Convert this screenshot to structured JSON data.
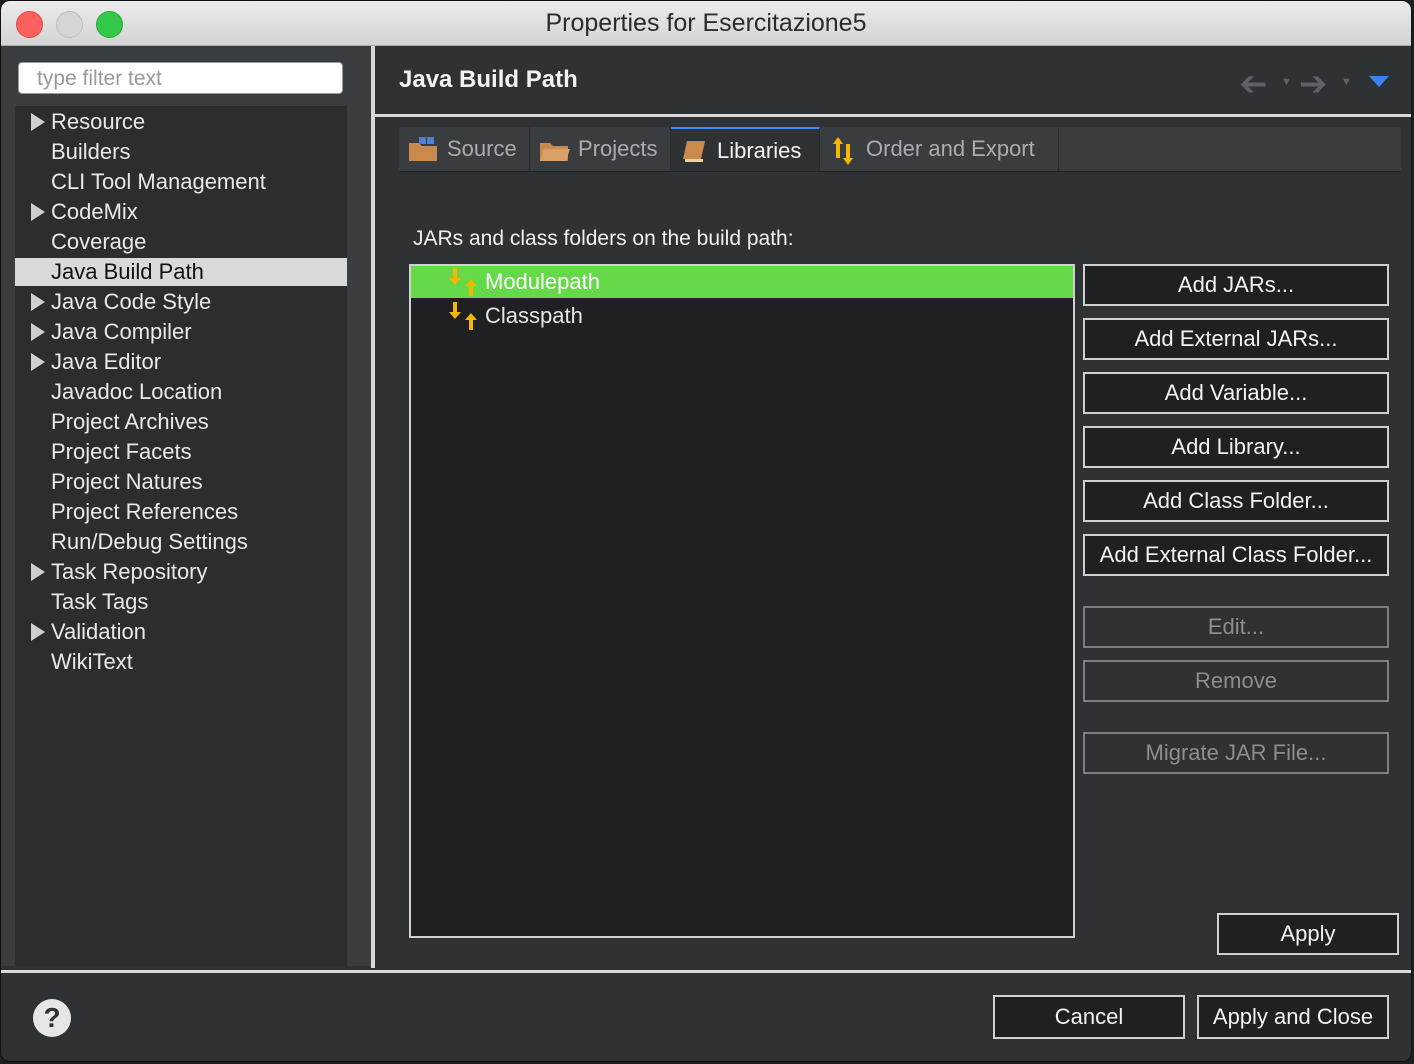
{
  "window": {
    "title": "Properties for Esercitazione5"
  },
  "sidebar": {
    "filter_placeholder": "type filter text",
    "items": [
      {
        "label": "Resource",
        "expandable": true
      },
      {
        "label": "Builders",
        "expandable": false
      },
      {
        "label": "CLI Tool Management",
        "expandable": false
      },
      {
        "label": "CodeMix",
        "expandable": true
      },
      {
        "label": "Coverage",
        "expandable": false
      },
      {
        "label": "Java Build Path",
        "expandable": false,
        "selected": true
      },
      {
        "label": "Java Code Style",
        "expandable": true
      },
      {
        "label": "Java Compiler",
        "expandable": true
      },
      {
        "label": "Java Editor",
        "expandable": true
      },
      {
        "label": "Javadoc Location",
        "expandable": false
      },
      {
        "label": "Project Archives",
        "expandable": false
      },
      {
        "label": "Project Facets",
        "expandable": false
      },
      {
        "label": "Project Natures",
        "expandable": false
      },
      {
        "label": "Project References",
        "expandable": false
      },
      {
        "label": "Run/Debug Settings",
        "expandable": false
      },
      {
        "label": "Task Repository",
        "expandable": true
      },
      {
        "label": "Task Tags",
        "expandable": false
      },
      {
        "label": "Validation",
        "expandable": true
      },
      {
        "label": "WikiText",
        "expandable": false
      }
    ]
  },
  "panel": {
    "title": "Java Build Path",
    "tabs": [
      {
        "label": "Source",
        "icon": "source-folder-icon"
      },
      {
        "label": "Projects",
        "icon": "folder-icon"
      },
      {
        "label": "Libraries",
        "icon": "library-book-icon",
        "active": true
      },
      {
        "label": "Order and Export",
        "icon": "order-arrows-icon"
      }
    ],
    "section_label": "JARs and class folders on the build path:",
    "entries": [
      {
        "label": "Modulepath",
        "selected": true
      },
      {
        "label": "Classpath",
        "selected": false
      }
    ],
    "buttons": {
      "add_jars": "Add JARs...",
      "add_external_jars": "Add External JARs...",
      "add_variable": "Add Variable...",
      "add_library": "Add Library...",
      "add_class_folder": "Add Class Folder...",
      "add_external_class_folder": "Add External Class Folder...",
      "edit": "Edit...",
      "remove": "Remove",
      "migrate_jar": "Migrate JAR File..."
    },
    "apply": "Apply"
  },
  "footer": {
    "help": "?",
    "cancel": "Cancel",
    "apply_and_close": "Apply and Close"
  },
  "colors": {
    "selection_green": "#66d94a",
    "accent_blue": "#3b82f6",
    "icon_yellow": "#f5b800"
  }
}
